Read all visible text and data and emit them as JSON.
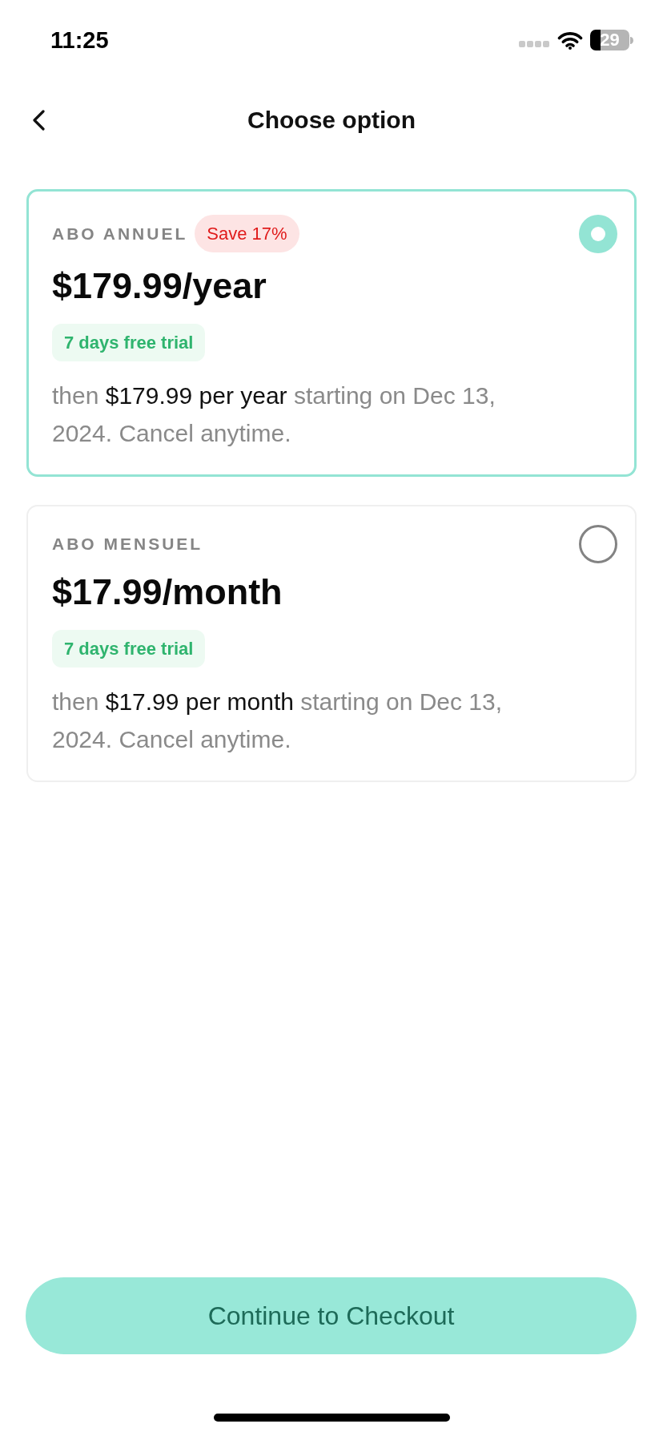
{
  "status_bar": {
    "time": "11:25",
    "battery": "29"
  },
  "header": {
    "title": "Choose option"
  },
  "plans": [
    {
      "name": "ABO ANNUEL",
      "badge": "Save 17%",
      "price": "$179.99/year",
      "trial": "7 days free trial",
      "description": "then **$179.99 per year** starting on Dec 13, 2024. Cancel anytime.",
      "selected": true
    },
    {
      "name": "ABO MENSUEL",
      "price": "$17.99/month",
      "trial": "7 days free trial",
      "description": "then **$17.99 per month** starting on Dec 13, 2024. Cancel anytime.",
      "selected": false
    }
  ],
  "checkout_button": {
    "label": "Continue to Checkout"
  }
}
